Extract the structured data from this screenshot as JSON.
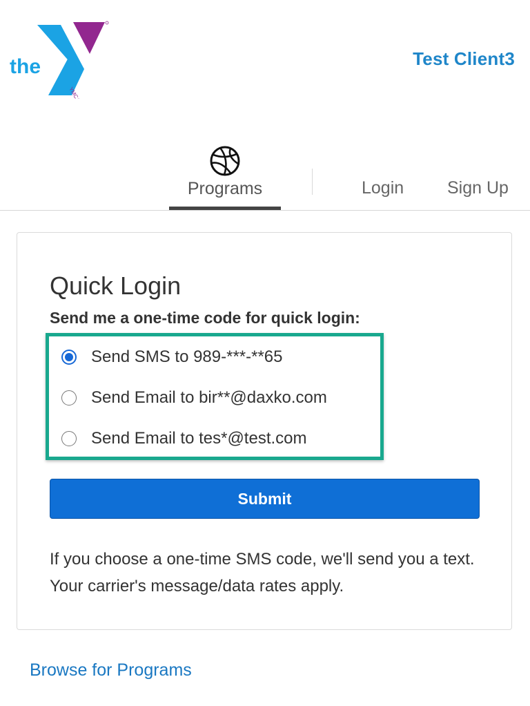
{
  "header": {
    "logo_alt": "the YMCA",
    "logo_word": "the",
    "logo_mark": "YMCA",
    "client_name": "Test Client3"
  },
  "nav": {
    "programs_icon": "basketball-icon",
    "programs_label": "Programs",
    "login_label": "Login",
    "signup_label": "Sign Up",
    "active": "Programs"
  },
  "quick_login": {
    "title": "Quick Login",
    "subtitle": "Send me a one-time code for quick login:",
    "options": [
      {
        "label": "Send SMS to 989-***-**65",
        "checked": true
      },
      {
        "label": "Send Email to bir**@daxko.com",
        "checked": false
      },
      {
        "label": "Send Email to tes*@test.com",
        "checked": false
      }
    ],
    "submit_label": "Submit",
    "info": "If you choose a one-time SMS code, we'll send you a text. Your carrier's message/data rates apply."
  },
  "footer": {
    "browse_link": "Browse for Programs"
  },
  "colors": {
    "brand_blue": "#1f86c9",
    "logo_blue": "#1ba3e4",
    "logo_purple": "#92278f",
    "button_blue": "#0f6fd6",
    "highlight_teal": "#19a88e"
  }
}
